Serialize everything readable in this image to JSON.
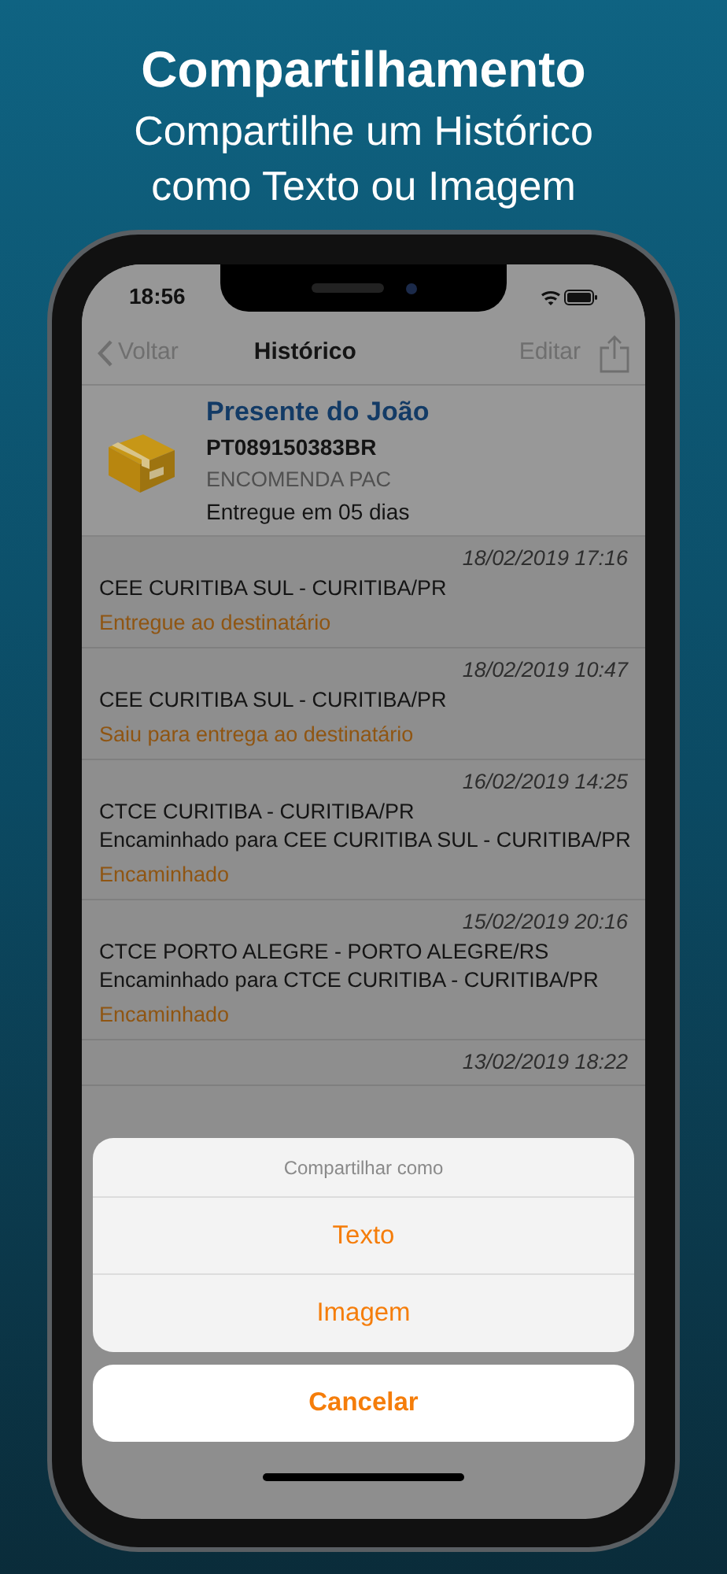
{
  "promo": {
    "title": "Compartilhamento",
    "subtitle": "Compartilhe um Histórico como Texto ou Imagem"
  },
  "status_bar": {
    "time": "18:56"
  },
  "nav": {
    "back": "Voltar",
    "title": "Histórico",
    "edit": "Editar"
  },
  "package": {
    "name": "Presente do João",
    "code": "PT089150383BR",
    "service": "ENCOMENDA PAC",
    "delivery": "Entregue em 05 dias"
  },
  "events": [
    {
      "date": "18/02/2019 17:16",
      "lines": [
        "CEE CURITIBA SUL - CURITIBA/PR"
      ],
      "status": "Entregue ao destinatário"
    },
    {
      "date": "18/02/2019 10:47",
      "lines": [
        "CEE CURITIBA SUL - CURITIBA/PR"
      ],
      "status": "Saiu para entrega ao destinatário"
    },
    {
      "date": "16/02/2019 14:25",
      "lines": [
        "CTCE CURITIBA - CURITIBA/PR",
        "Encaminhado para CEE CURITIBA SUL - CURITIBA/PR"
      ],
      "status": "Encaminhado"
    },
    {
      "date": "15/02/2019 20:16",
      "lines": [
        "CTCE PORTO ALEGRE - PORTO ALEGRE/RS",
        "Encaminhado para CTCE CURITIBA - CURITIBA/PR"
      ],
      "status": "Encaminhado"
    },
    {
      "date": "13/02/2019 18:22"
    }
  ],
  "action_sheet": {
    "title": "Compartilhar como",
    "options": [
      "Texto",
      "Imagem"
    ],
    "cancel": "Cancelar"
  }
}
